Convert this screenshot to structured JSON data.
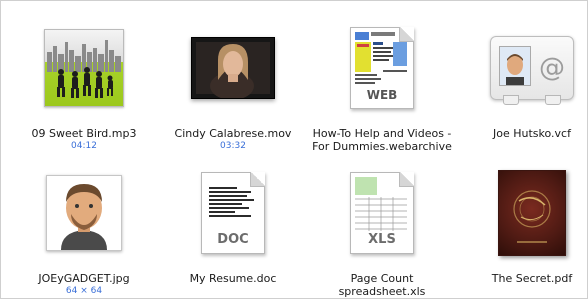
{
  "files": [
    {
      "name": "09 Sweet Bird.mp3",
      "detail": "04:12",
      "icon": "audio-album-art-icon"
    },
    {
      "name": "Cindy Calabrese.mov",
      "detail": "03:32",
      "icon": "video-thumbnail-icon"
    },
    {
      "name_line1": "How-To Help and Videos -",
      "name_line2": "For Dummies.webarchive",
      "badge": "WEB",
      "icon": "webarchive-icon"
    },
    {
      "name": "Joe Hutsko.vcf",
      "icon": "vcard-icon"
    },
    {
      "name": "JOEyGADGET.jpg",
      "detail": "64 × 64",
      "icon": "image-avatar-icon"
    },
    {
      "name": "My Resume.doc",
      "badge": "DOC",
      "icon": "word-document-icon"
    },
    {
      "name_line1": "Page Count",
      "name_line2": "spreadsheet.xls",
      "badge": "XLS",
      "icon": "excel-spreadsheet-icon"
    },
    {
      "name": "The Secret.pdf",
      "icon": "pdf-book-cover-icon"
    }
  ],
  "colors": {
    "detail_text": "#3a6fd8",
    "name_text": "#1a1a1a",
    "album_green": "#a8d22a"
  }
}
